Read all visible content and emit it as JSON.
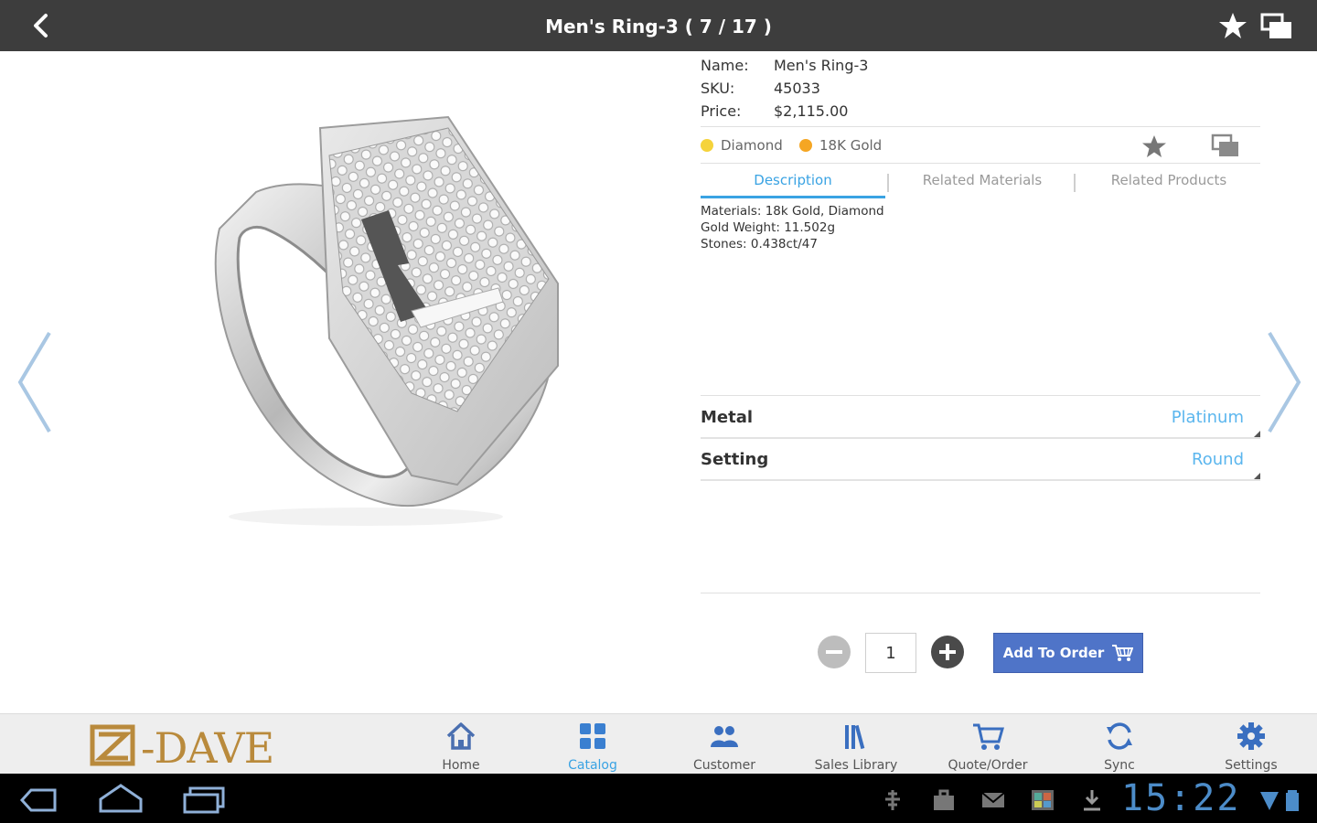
{
  "topbar": {
    "title": "Men's Ring-3 ( 7 / 17 )",
    "back_icon": "back-arrow-icon",
    "star_icon": "star-icon",
    "compare_icon": "compare-icon"
  },
  "product": {
    "image_icon": "ring-image",
    "name_label": "Name:",
    "name": "Men's Ring-3",
    "sku_label": "SKU:",
    "sku": "45033",
    "price_label": "Price:",
    "price": "$2,115.00",
    "attributes": [
      {
        "label": "Diamond",
        "color": "#f5d33b"
      },
      {
        "label": "18K Gold",
        "color": "#f5a623"
      }
    ]
  },
  "tabs": [
    {
      "label": "Description",
      "active": true
    },
    {
      "label": "Related Materials",
      "active": false
    },
    {
      "label": "Related Products",
      "active": false
    }
  ],
  "description": {
    "materials": "Materials: 18k Gold, Diamond",
    "gold_weight": "Gold Weight: 11.502g",
    "stones": "Stones: 0.438ct/47"
  },
  "options": [
    {
      "name": "Metal",
      "value": "Platinum"
    },
    {
      "name": "Setting",
      "value": "Round"
    }
  ],
  "order": {
    "quantity": "1",
    "add_label": "Add To Order"
  },
  "bottom_nav": {
    "logo": "-DAVE",
    "items": [
      {
        "label": "Home",
        "icon": "home-icon"
      },
      {
        "label": "Catalog",
        "icon": "catalog-icon",
        "active": true
      },
      {
        "label": "Customer",
        "icon": "customer-icon"
      },
      {
        "label": "Sales Library",
        "icon": "library-icon"
      },
      {
        "label": "Quote/Order",
        "icon": "cart-icon"
      },
      {
        "label": "Sync",
        "icon": "sync-icon"
      },
      {
        "label": "Settings",
        "icon": "settings-icon"
      }
    ]
  },
  "system_bar": {
    "time": "15:22"
  },
  "colors": {
    "accent": "#3aa3e3",
    "topbar": "#3d3d3d",
    "button": "#4f74c8",
    "brand_gold": "#b98a3c"
  }
}
